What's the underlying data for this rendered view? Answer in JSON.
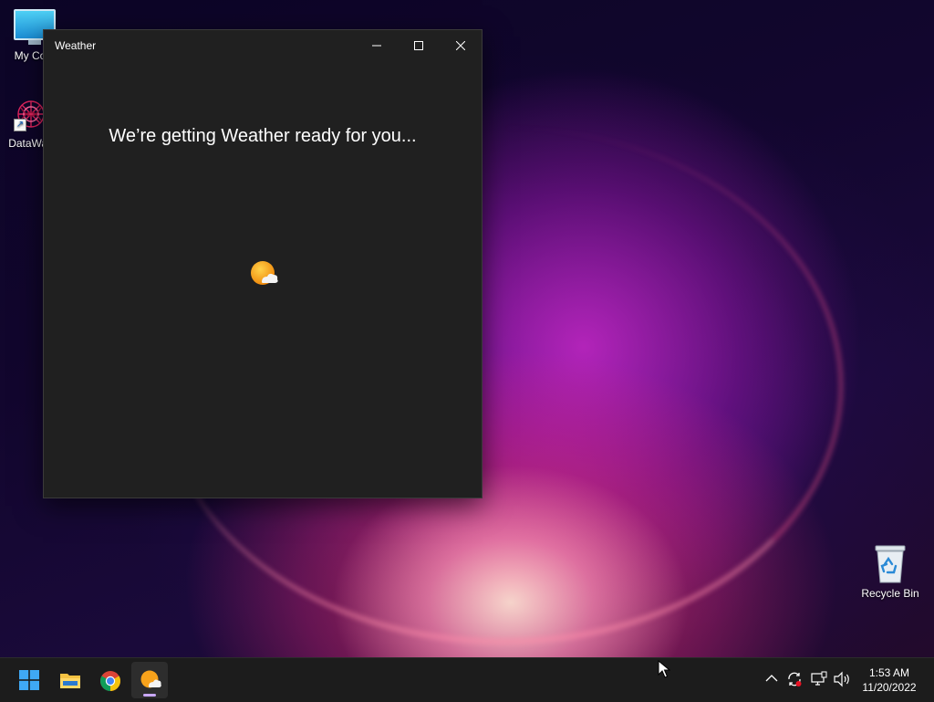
{
  "desktop": {
    "icons": [
      {
        "label": "My Com",
        "icon": "computer-icon"
      },
      {
        "label": "DataWag",
        "icon": "datawag-shortcut-icon"
      }
    ],
    "recycle_bin": {
      "label": "Recycle Bin",
      "icon": "recycle-bin-icon"
    }
  },
  "window": {
    "title": "Weather",
    "loading_message": "We’re getting Weather ready for you...",
    "controls": {
      "minimize": "minimize-icon",
      "maximize": "maximize-icon",
      "close": "close-icon"
    },
    "spinner_icon": "weather-sun-cloud-icon"
  },
  "taskbar": {
    "apps": [
      {
        "name": "Start",
        "icon": "windows-start-icon"
      },
      {
        "name": "File Explorer",
        "icon": "folder-icon"
      },
      {
        "name": "Google Chrome",
        "icon": "chrome-icon"
      },
      {
        "name": "Weather",
        "icon": "weather-icon",
        "active": true
      }
    ],
    "tray": [
      "chevron-up-icon",
      "sync-icon",
      "network-icon",
      "volume-icon"
    ],
    "clock": {
      "time": "1:53 AM",
      "date": "11/20/2022"
    }
  },
  "colors": {
    "window_bg": "#202020",
    "taskbar_bg": "#1c1c1c",
    "accent": "#c9a8ff",
    "weather_sun": "#f7a21b"
  }
}
